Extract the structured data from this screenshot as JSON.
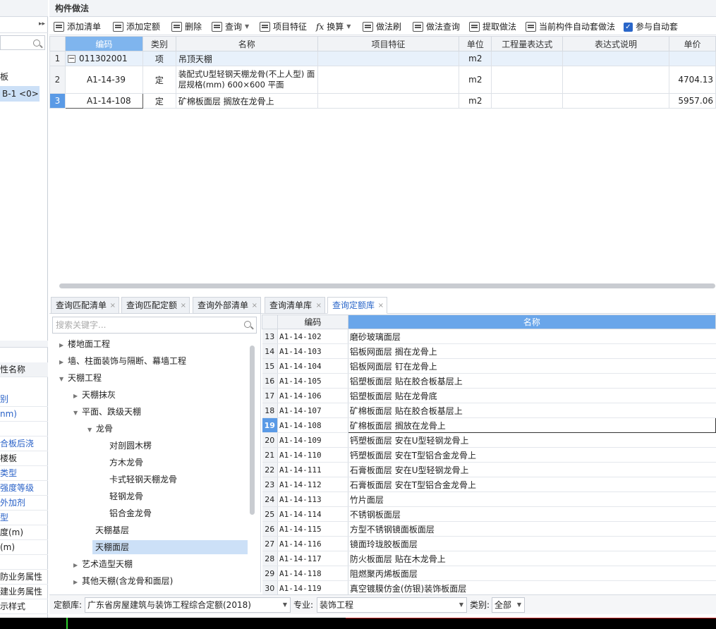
{
  "left_panel": {
    "items": [
      "板",
      "B-1 <0>"
    ],
    "props_header": "性名称",
    "props": [
      "别",
      "nm)",
      "",
      "合板后浇",
      "楼板",
      "类型",
      "强度等级",
      "外加剂",
      "型",
      "度(m)",
      "(m)",
      "",
      "防业务属性",
      "建业务属性",
      "示样式"
    ]
  },
  "panel_title": "构件做法",
  "toolbar": {
    "add_list": "添加清单",
    "add_quota": "添加定额",
    "delete": "删除",
    "query": "查询",
    "item_feature": "项目特征",
    "convert": "换算",
    "brush": "做法刷",
    "query_method": "做法查询",
    "extract": "提取做法",
    "auto_set": "当前构件自动套做法",
    "participate": "参与自动套"
  },
  "grid": {
    "columns": [
      "",
      "编码",
      "类别",
      "名称",
      "项目特征",
      "单位",
      "工程量表达式",
      "表达式说明",
      "单价"
    ],
    "rows": [
      {
        "num": "1",
        "code": "011302001",
        "type": "项",
        "name": "吊顶天棚",
        "unit": "m2",
        "price": ""
      },
      {
        "num": "2",
        "code": "A1-14-39",
        "type": "定",
        "name": "装配式U型轻钢天棚龙骨(不上人型) 面层规格(mm) 600×600 平面",
        "unit": "m2",
        "price": "4704.13"
      },
      {
        "num": "3",
        "code": "A1-14-108",
        "type": "定",
        "name": "矿棉板面层 搁放在龙骨上",
        "unit": "m2",
        "price": "5957.06"
      }
    ]
  },
  "tabs": [
    "查询匹配清单",
    "查询匹配定额",
    "查询外部清单",
    "查询清单库",
    "查询定额库"
  ],
  "tree": {
    "search_placeholder": "搜索关键字...",
    "nodes": [
      "楼地面工程",
      "墙、柱面装饰与隔断、幕墙工程",
      "天棚工程",
      "天棚抹灰",
      "平面、跌级天棚",
      "龙骨",
      "对剖圆木楞",
      "方木龙骨",
      "卡式轻钢天棚龙骨",
      "轻钢龙骨",
      "铝合金龙骨",
      "天棚基层",
      "天棚面层",
      "艺术造型天棚",
      "其他天棚(含龙骨和面层)"
    ]
  },
  "list": {
    "headers": [
      "编码",
      "名称"
    ],
    "rows": [
      {
        "num": "13",
        "code": "A1-14-102",
        "name": "磨砂玻璃面层"
      },
      {
        "num": "14",
        "code": "A1-14-103",
        "name": "铝板网面层 搁在龙骨上"
      },
      {
        "num": "15",
        "code": "A1-14-104",
        "name": "铝板网面层 钉在龙骨上"
      },
      {
        "num": "16",
        "code": "A1-14-105",
        "name": "铝塑板面层 贴在胶合板基层上"
      },
      {
        "num": "17",
        "code": "A1-14-106",
        "name": "铝塑板面层 贴在龙骨底"
      },
      {
        "num": "18",
        "code": "A1-14-107",
        "name": "矿棉板面层 贴在胶合板基层上"
      },
      {
        "num": "19",
        "code": "A1-14-108",
        "name": "矿棉板面层 搁放在龙骨上"
      },
      {
        "num": "20",
        "code": "A1-14-109",
        "name": "钙塑板面层 安在U型轻钢龙骨上"
      },
      {
        "num": "21",
        "code": "A1-14-110",
        "name": "钙塑板面层 安在T型铝合金龙骨上"
      },
      {
        "num": "22",
        "code": "A1-14-111",
        "name": "石膏板面层 安在U型轻钢龙骨上"
      },
      {
        "num": "23",
        "code": "A1-14-112",
        "name": "石膏板面层 安在T型铝合金龙骨上"
      },
      {
        "num": "24",
        "code": "A1-14-113",
        "name": "竹片面层"
      },
      {
        "num": "25",
        "code": "A1-14-114",
        "name": "不锈钢板面层"
      },
      {
        "num": "26",
        "code": "A1-14-115",
        "name": "方型不锈钢镜面板面层"
      },
      {
        "num": "27",
        "code": "A1-14-116",
        "name": "镜面玲珑胶板面层"
      },
      {
        "num": "28",
        "code": "A1-14-117",
        "name": "防火板面层 贴在木龙骨上"
      },
      {
        "num": "29",
        "code": "A1-14-118",
        "name": "阻燃聚丙烯板面层"
      },
      {
        "num": "30",
        "code": "A1-14-119",
        "name": "真空镀膜仿金(仿银)装饰板面层"
      }
    ]
  },
  "bottom": {
    "lib_label": "定额库:",
    "lib_value": "广东省房屋建筑与装饰工程综合定额(2018)",
    "spec_label": "专业:",
    "spec_value": "装饰工程",
    "cat_label": "类别:",
    "cat_value": "全部"
  }
}
